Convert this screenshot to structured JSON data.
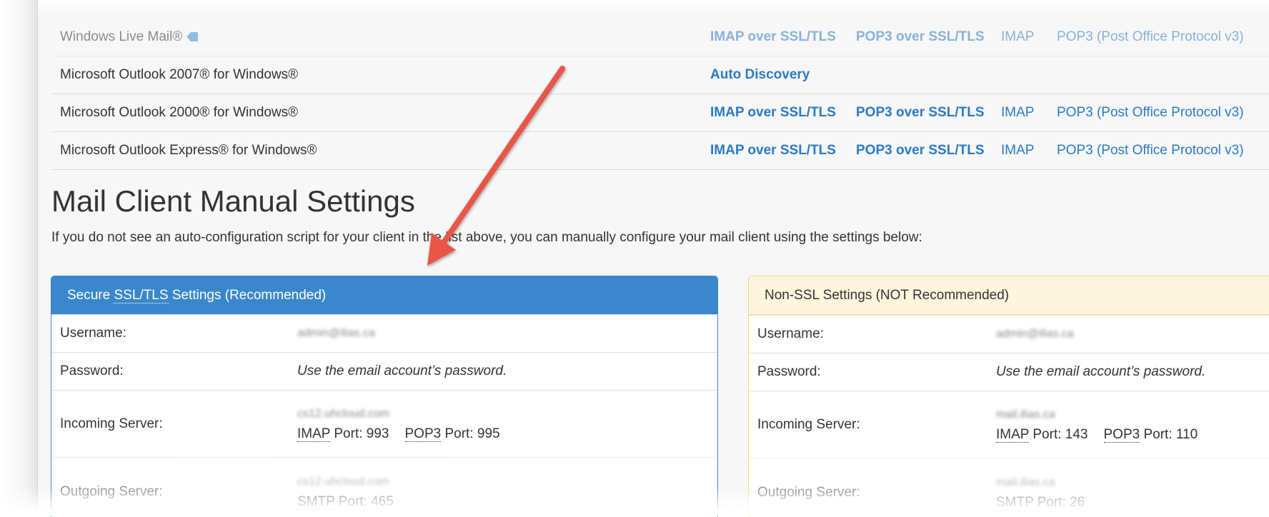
{
  "clients": [
    {
      "name": "Windows Live Mail®",
      "has_icon": true,
      "links": [
        "IMAP over SSL/TLS",
        "POP3 over SSL/TLS",
        "IMAP",
        "POP3 (Post Office Protocol v3)"
      ]
    },
    {
      "name": "Microsoft Outlook 2007® for Windows®",
      "links": [
        "Auto Discovery"
      ]
    },
    {
      "name": "Microsoft Outlook 2000® for Windows®",
      "links": [
        "IMAP over SSL/TLS",
        "POP3 over SSL/TLS",
        "IMAP",
        "POP3 (Post Office Protocol v3)"
      ]
    },
    {
      "name": "Microsoft Outlook Express® for Windows®",
      "links": [
        "IMAP over SSL/TLS",
        "POP3 over SSL/TLS",
        "IMAP",
        "POP3 (Post Office Protocol v3)"
      ]
    }
  ],
  "icons": {
    "client_icon": "tag-icon",
    "annotation": "red-arrow-icon"
  },
  "section": {
    "title": "Mail Client Manual Settings",
    "intro": "If you do not see an auto-configuration script for your client in the list above, you can manually configure your mail client using the settings below:"
  },
  "secure": {
    "heading_pre": "Secure ",
    "heading_abbr": "SSL/TLS",
    "heading_post": " Settings (Recommended)",
    "username_label": "Username:",
    "username_value": "admin@ilias.ca",
    "password_label": "Password:",
    "password_value": "Use the email account’s password.",
    "incoming_label": "Incoming Server:",
    "incoming_host": "cs12.uhcloud.com",
    "incoming_imap_abbr": "IMAP",
    "incoming_imap_port": " Port: 993",
    "incoming_pop3_abbr": "POP3",
    "incoming_pop3_port": " Port: 995",
    "outgoing_label": "Outgoing Server:",
    "outgoing_host": "cs12.uhcloud.com",
    "outgoing_smtp_abbr": "SMTP",
    "outgoing_smtp_port": " Port: 465"
  },
  "nonssl": {
    "heading": "Non-SSL Settings (NOT Recommended)",
    "username_label": "Username:",
    "username_value": "admin@ilias.ca",
    "password_label": "Password:",
    "password_value": "Use the email account’s password.",
    "incoming_label": "Incoming Server:",
    "incoming_host": "mail.ilias.ca",
    "incoming_imap_abbr": "IMAP",
    "incoming_imap_port": " Port: 143",
    "incoming_pop3_abbr": "POP3",
    "incoming_pop3_port": " Port: 110",
    "outgoing_label": "Outgoing Server:",
    "outgoing_host": "mail.ilias.ca",
    "outgoing_smtp_abbr": "SMTP",
    "outgoing_smtp_port": " Port: 26"
  },
  "colors": {
    "link": "#2a7ac4",
    "secure_panel": "#3a87cc",
    "nonssl_border": "#f4d77d",
    "nonssl_heading_bg": "#fcf6dd",
    "arrow": "#e8564a"
  }
}
